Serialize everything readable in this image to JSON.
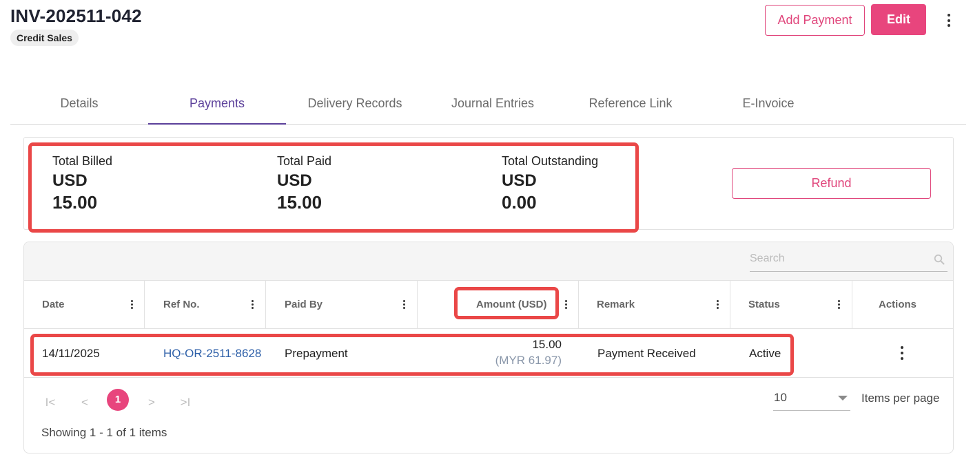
{
  "header": {
    "title": "INV-202511-042",
    "badge": "Credit Sales",
    "add_payment_label": "Add Payment",
    "edit_label": "Edit"
  },
  "tabs": [
    {
      "label": "Details",
      "active": false
    },
    {
      "label": "Payments",
      "active": true
    },
    {
      "label": "Delivery Records",
      "active": false
    },
    {
      "label": "Journal Entries",
      "active": false
    },
    {
      "label": "Reference Link",
      "active": false
    },
    {
      "label": "E-Invoice",
      "active": false
    }
  ],
  "summary": {
    "billed_label": "Total Billed",
    "billed_currency": "USD",
    "billed_value": "15.00",
    "paid_label": "Total Paid",
    "paid_currency": "USD",
    "paid_value": "15.00",
    "outstanding_label": "Total Outstanding",
    "outstanding_currency": "USD",
    "outstanding_value": "0.00",
    "refund_label": "Refund"
  },
  "grid": {
    "search_placeholder": "Search",
    "columns": {
      "date": "Date",
      "ref_no": "Ref No.",
      "paid_by": "Paid By",
      "amount": "Amount (USD)",
      "remark": "Remark",
      "status": "Status",
      "actions": "Actions"
    },
    "rows": [
      {
        "date": "14/11/2025",
        "ref_no": "HQ-OR-2511-8628",
        "paid_by": "Prepayment",
        "amount": "15.00",
        "amount_local": "(MYR 61.97)",
        "remark": "Payment Received",
        "status": "Active"
      }
    ],
    "pager": {
      "first": "I<",
      "prev": "<",
      "current_page": "1",
      "next": ">",
      "last": ">I",
      "per_page_value": "10",
      "per_page_label": "Items per page",
      "showing": "Showing 1 - 1 of 1 items"
    }
  },
  "colors": {
    "accent": "#e8457d",
    "tab_active": "#5b3f9a",
    "link": "#2d5fa8",
    "highlight": "#ea4747"
  },
  "icons": [
    "more-vertical-icon",
    "search-icon",
    "first-page-icon",
    "prev-page-icon",
    "next-page-icon",
    "last-page-icon",
    "chevron-down-icon"
  ]
}
